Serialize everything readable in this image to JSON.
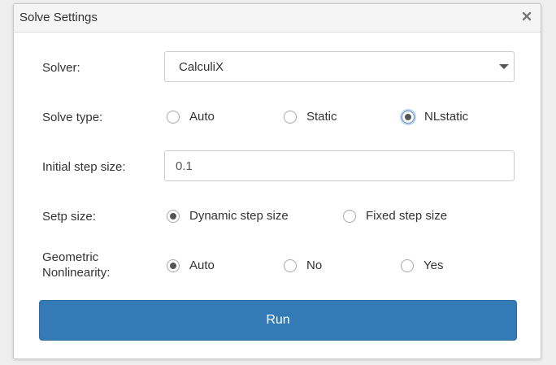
{
  "dialog": {
    "title": "Solve Settings",
    "close_icon": "close-icon"
  },
  "solver": {
    "label": "Solver:",
    "selected": "CalculiX"
  },
  "solve_type": {
    "label": "Solve type:",
    "options": [
      "Auto",
      "Static",
      "NLstatic"
    ],
    "selected": "NLstatic"
  },
  "initial_step": {
    "label": "Initial step size:",
    "value": "0.1"
  },
  "step_size": {
    "label": "Setp size:",
    "options": [
      "Dynamic step size",
      "Fixed step size"
    ],
    "selected": "Dynamic step size"
  },
  "geometric": {
    "label_line1": "Geometric",
    "label_line2": "Nonlinearity:",
    "options": [
      "Auto",
      "No",
      "Yes"
    ],
    "selected": "Auto"
  },
  "run_button": {
    "label": "Run"
  },
  "colors": {
    "primary": "#337ab7",
    "primary_border": "#2e6da4",
    "text": "#333333"
  }
}
